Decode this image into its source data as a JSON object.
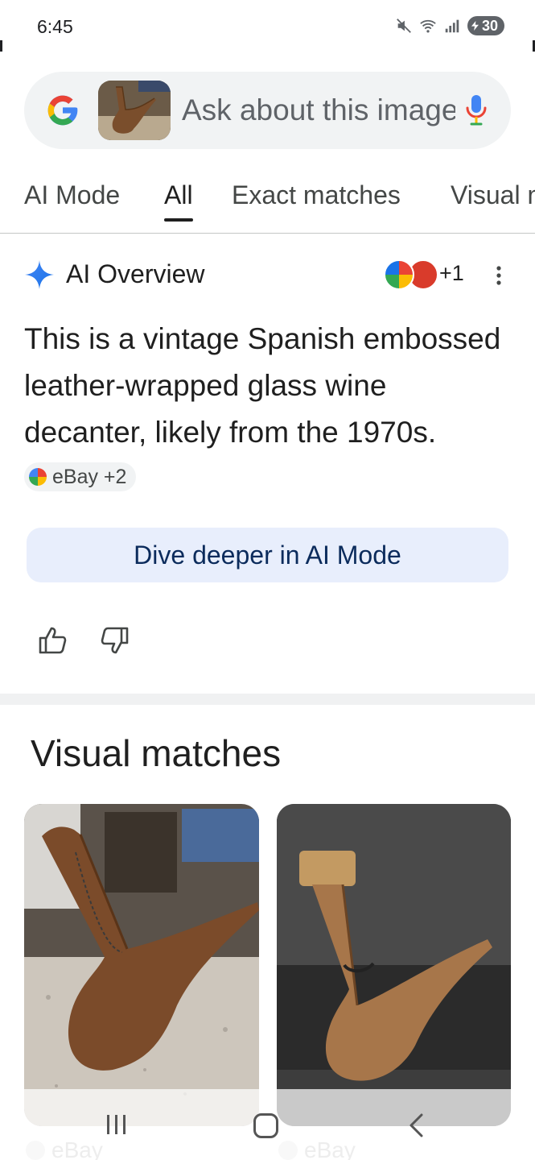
{
  "status_bar": {
    "time": "6:45",
    "battery": "30"
  },
  "search": {
    "placeholder": "Ask about this image"
  },
  "tabs": [
    {
      "label": "AI Mode"
    },
    {
      "label": "All"
    },
    {
      "label": "Exact matches"
    },
    {
      "label": "Visual matches"
    }
  ],
  "ai_overview": {
    "title": "AI Overview",
    "sources_more": "+1",
    "text": "This is a vintage Spanish embossed leather-wrapped glass wine decanter, likely from the 1970s.",
    "citation": "eBay +2",
    "dive_button": "Dive deeper in AI Mode"
  },
  "visual_matches": {
    "title": "Visual matches",
    "items": [
      {
        "source": "eBay"
      },
      {
        "source": "eBay"
      }
    ]
  },
  "colors": {
    "accent_blue": "#4285f4",
    "dive_bg": "#e8eefc",
    "dive_text": "#0b2b5c"
  }
}
